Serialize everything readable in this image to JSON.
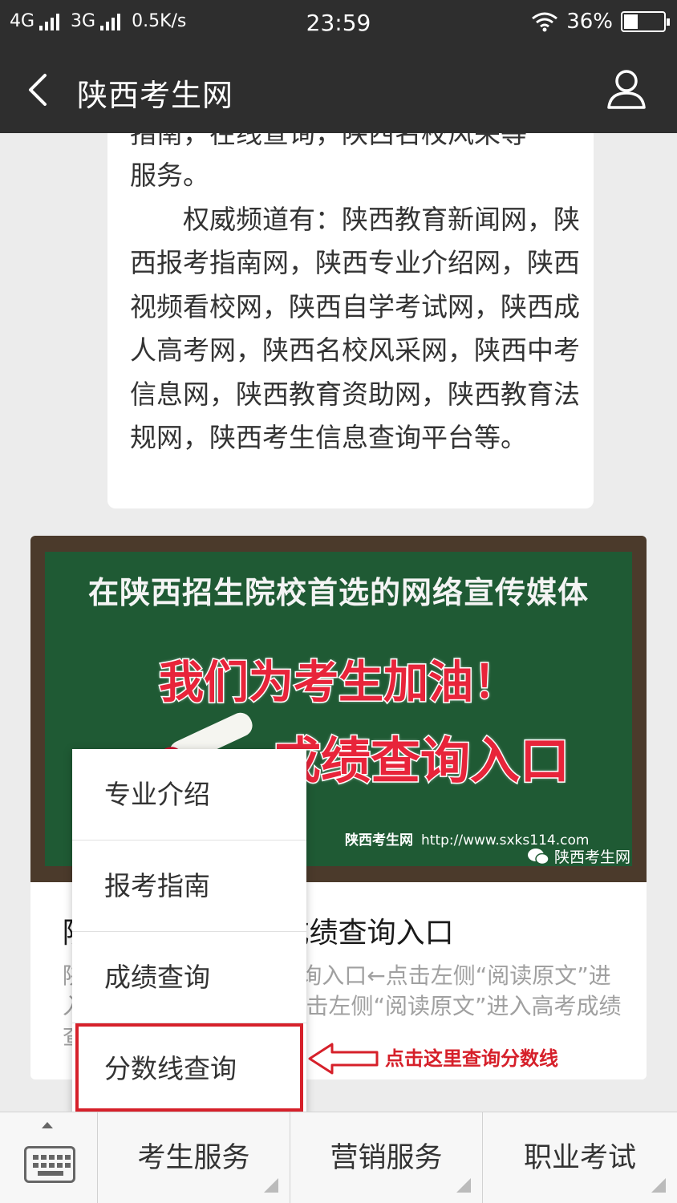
{
  "status_bar": {
    "network_left": "4G",
    "network_mid": "3G",
    "speed": "0.5K/s",
    "time": "23:59",
    "battery": "36%",
    "battery_level": 0.36
  },
  "nav": {
    "title": "陕西考生网",
    "back_icon": "chevron-left-icon",
    "profile_icon": "person-icon"
  },
  "article": {
    "cut_line": "指南，在线查询，陕西名校风采等",
    "paragraphs": [
      "服务。",
      "　　权威频道有：陕西教育新闻网，陕西报考指南网，陕西专业介绍网，陕西视频看校网，陕西自学考试网，陕西成人高考网，陕西名校风采网，陕西中考信息网，陕西教育资助网，陕西教育法规网，陕西考生信息查询平台等。"
    ]
  },
  "card": {
    "banner_line1": "在陕西招生院校首选的网络宣传媒体",
    "banner_line2": "我们为考生加油！",
    "banner_line3": "成绩查询入口",
    "banner_site_name": "陕西考生网",
    "banner_site_url": "http://www.sxks114.com",
    "banner_watermark": "陕西考生网",
    "title": "陕西2017年高考成绩查询入口",
    "desc": "陕西2017年高考成绩查询入口←点击左侧“阅读原文”进入高考成绩查询入口←点击左侧“阅读原文”进入高考成绩查询"
  },
  "popup": {
    "items": [
      "专业介绍",
      "报考指南",
      "成绩查询",
      "分数线查询"
    ]
  },
  "annotation": {
    "hint": "点击这里查询分数线",
    "color": "#d6202a"
  },
  "bottom_menu": {
    "keyboard_icon": "keyboard-icon",
    "items": [
      "考生服务",
      "营销服务",
      "职业考试"
    ]
  }
}
